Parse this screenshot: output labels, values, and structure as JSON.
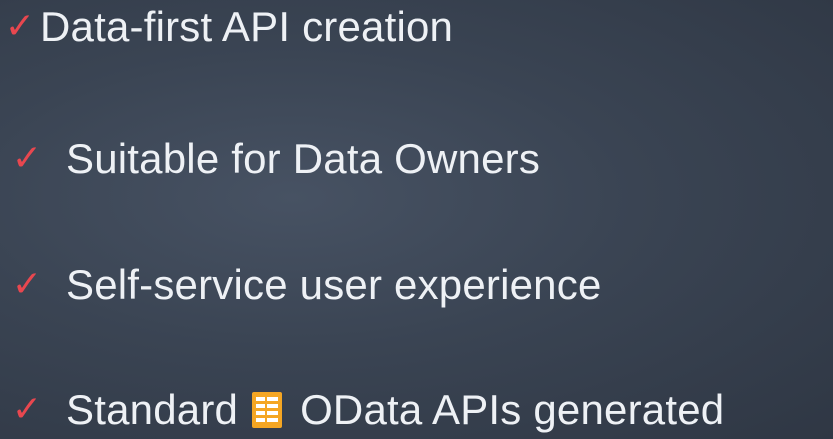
{
  "bullets": [
    {
      "text": "Data-first API creation",
      "icon": "checkmark-icon"
    },
    {
      "text": "Suitable for Data Owners",
      "icon": "checkmark-icon"
    },
    {
      "text": "Self-service user experience",
      "icon": "checkmark-icon"
    },
    {
      "text_before": "Standard",
      "text_after": "OData APIs generated",
      "icon": "checkmark-icon",
      "inline_icon": "odata-logo-icon"
    }
  ],
  "colors": {
    "background": "#3a4453",
    "text": "#eef1f5",
    "check": "#e8474f",
    "odata_logo": "#f5a623"
  }
}
